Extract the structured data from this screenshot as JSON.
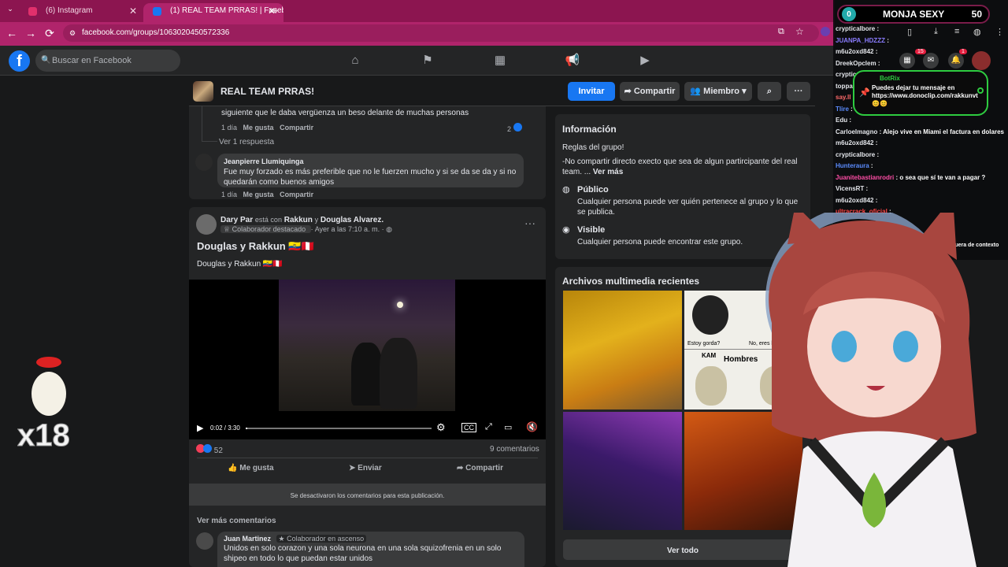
{
  "browser": {
    "tabs": [
      {
        "title": "(6) Instagram",
        "color": "#e1306c"
      },
      {
        "title": "(1) REAL TEAM PRRAS! | Faceb",
        "color": "#1877f2"
      }
    ],
    "url": "facebook.com/groups/1063020450572336",
    "menu_badge": "15",
    "notif_badge": "1"
  },
  "header": {
    "logo": "f",
    "search_placeholder": "Buscar en Facebook"
  },
  "group": {
    "name": "REAL TEAM PRRAS!",
    "invite": "Invitar",
    "share": "Compartir",
    "member": "Miembro"
  },
  "comments_top": {
    "truncated_text": "siguiente que le daba vergüenza un beso delante de muchas personas",
    "time": "1 día",
    "like": "Me gusta",
    "share": "Compartir",
    "reaction_count": "2",
    "view_reply": "Ver 1 respuesta",
    "second": {
      "author": "Jeanpierre Llumiquinga",
      "text": "Fue muy forzado es más preferible que no le fuerzen mucho y si se da se da y si no quedarán como buenos amigos",
      "time": "1 día",
      "like": "Me gusta",
      "share": "Compartir"
    }
  },
  "post": {
    "author": "Dary Par",
    "with_text": "está con",
    "tag1": "Rakkun",
    "and_text": "y",
    "tag2": "Douglas Alvarez.",
    "badge": "Colaborador destacado",
    "time": "Ayer a las 7:10 a. m.",
    "title": "Douglas y Rakkun 🇪🇨🇵🇪",
    "body": "Douglas y Rakkun 🇪🇨🇵🇪",
    "video_time": "0:02 / 3:30",
    "video_progress": 0.01,
    "reactions": "52",
    "comments_count": "9 comentarios",
    "like": "Me gusta",
    "send": "Enviar",
    "share": "Compartir",
    "comments_disabled": "Se desactivaron los comentarios para esta publicación.",
    "more_comments": "Ver más comentarios",
    "c1_author": "Juan Martinez",
    "c1_badge": "Colaborador en ascenso",
    "c1_text": "Unidos en solo corazon y una sola neurona en una sola squizofrenia en un solo shipeo en todo lo que puedan estar unidos"
  },
  "info": {
    "title": "Información",
    "rules": "Reglas del grupo!",
    "rule_text": "-No compartir directo execto que sea de algun partircipante del real team. ...",
    "see_more": "Ver más",
    "public_title": "Público",
    "public_desc": "Cualquier persona puede ver quién pertenece al grupo y lo que se publica.",
    "visible_title": "Visible",
    "visible_desc": "Cualquier persona puede encontrar este grupo."
  },
  "media": {
    "title": "Archivos multimedia recientes",
    "see_all": "Ver todo",
    "meme_top": "Estoy gorda?",
    "meme_top2": "No, eres h",
    "meme_kam": "KAM",
    "meme_hombres": "Hombres"
  },
  "stream": {
    "poll_name": "MONJA SEXY",
    "poll_left": "0",
    "poll_right": "50",
    "botrix_name": "BotRix",
    "botrix_msg": "Puedes dejar tu mensaje en https://www.donoclip.com/rakkunvt 😊😊",
    "chat": [
      {
        "user": "crypticalbore",
        "msg": "",
        "color": "#e4e6eb"
      },
      {
        "user": "JUANPA_HDZZZ",
        "msg": "",
        "color": "#8a7cff"
      },
      {
        "user": "m6u2oxd842",
        "msg": "",
        "color": "#e4e6eb"
      },
      {
        "user": "DreekOpclem",
        "msg": "",
        "color": "#e4e6eb"
      },
      {
        "user": "crypticalbore",
        "msg": "",
        "color": "#e4e6eb"
      },
      {
        "user": "toppass",
        "msg": "",
        "color": "#e4e6eb"
      },
      {
        "user": "say.ll",
        "msg": "",
        "color": "#ff6a6a"
      },
      {
        "user": "Tlire",
        "msg": "",
        "color": "#5b8cff"
      },
      {
        "user": "Edu",
        "msg": "",
        "color": "#e4e6eb"
      },
      {
        "user": "Carloelmagno",
        "msg": "Alejo vive en Miami el factura en dolares",
        "color": "#e4e6eb"
      },
      {
        "user": "m6u2oxd842",
        "msg": "",
        "color": "#e4e6eb"
      },
      {
        "user": "crypticalbore",
        "msg": "",
        "color": "#e4e6eb"
      },
      {
        "user": "Hunteraura",
        "msg": "",
        "color": "#5b8cff"
      },
      {
        "user": "Juanitebastianrodri",
        "msg": "o sea que sí te van a pagar ?",
        "color": "#ff4da6"
      },
      {
        "user": "VicensRT",
        "msg": "",
        "color": "#e4e6eb"
      },
      {
        "user": "m6u2oxd842",
        "msg": "",
        "color": "#e4e6eb"
      },
      {
        "user": "ultracrack_oficial",
        "msg": "",
        "color": "#ff4444"
      }
    ],
    "chat_tail1": "fuera de contexto",
    "x18": "x18"
  }
}
